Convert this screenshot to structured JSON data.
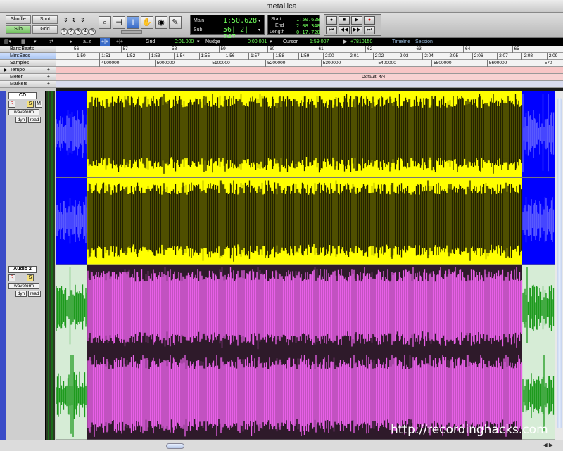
{
  "window": {
    "title": "metallica"
  },
  "edit_modes": {
    "shuffle": "Shuffle",
    "spot": "Spot",
    "slip": "Slip",
    "grid": "Grid"
  },
  "zoom_presets": [
    "1",
    "2",
    "3",
    "4",
    "5"
  ],
  "counters": {
    "main_label": "Main",
    "main_value": "1:50.628",
    "sub_label": "Sub",
    "sub_value": "56| 2| 247",
    "start_label": "Start",
    "start_value": "1:50.628",
    "end_label": "End",
    "end_value": "2:08.348",
    "length_label": "Length",
    "length_value": "0:17.720"
  },
  "gridbar": {
    "grid_label": "Grid",
    "grid_value": "0:01.000",
    "nudge_label": "Nudge",
    "nudge_value": "0:00.001",
    "cursor_label": "Cursor",
    "cursor_value": "1:59.007",
    "offset_value": "+7810150",
    "timeline_label": "Timeline",
    "session_label": "Session"
  },
  "rulers": {
    "bars_beats": "Bars:Beats",
    "min_secs": "Min:Secs",
    "samples": "Samples",
    "tempo": "Tempo",
    "meter": "Meter",
    "markers": "Markers",
    "meter_marker": "Default: 4/4",
    "bars_ticks": [
      "56",
      "57",
      "58",
      "59",
      "60",
      "61",
      "62",
      "63",
      "64",
      "65"
    ],
    "minsec_ticks": [
      "1:50",
      "1:51",
      "1:52",
      "1:53",
      "1:54",
      "1:55",
      "1:56",
      "1:57",
      "1:58",
      "1:59",
      "2:00",
      "2:01",
      "2:02",
      "2:03",
      "2:04",
      "2:05",
      "2:06",
      "2:07",
      "2:08",
      "2:09"
    ],
    "sample_ticks": [
      "4900000",
      "5000000",
      "5100000",
      "5200000",
      "5300000",
      "5400000",
      "5500000",
      "5600000",
      "570"
    ]
  },
  "tracks": [
    {
      "name": "CD",
      "rec": "R",
      "solo": "S",
      "mute": "M",
      "view": "waveform",
      "dyn": "dyn",
      "read": "read",
      "region_color": "#ffff00",
      "outside_color": "#0000ff",
      "wave_color": "#222200"
    },
    {
      "name": "Audio 2",
      "rec": "R",
      "solo": "S",
      "view": "waveform",
      "dyn": "dyn",
      "read": "read",
      "region_color": "#2e1a2a",
      "outside_color": "#d6ecd6",
      "wave_color": "#e860e8",
      "outside_wave_color": "#1c9a1c"
    }
  ],
  "watermark": "http://recordinghacks.com"
}
